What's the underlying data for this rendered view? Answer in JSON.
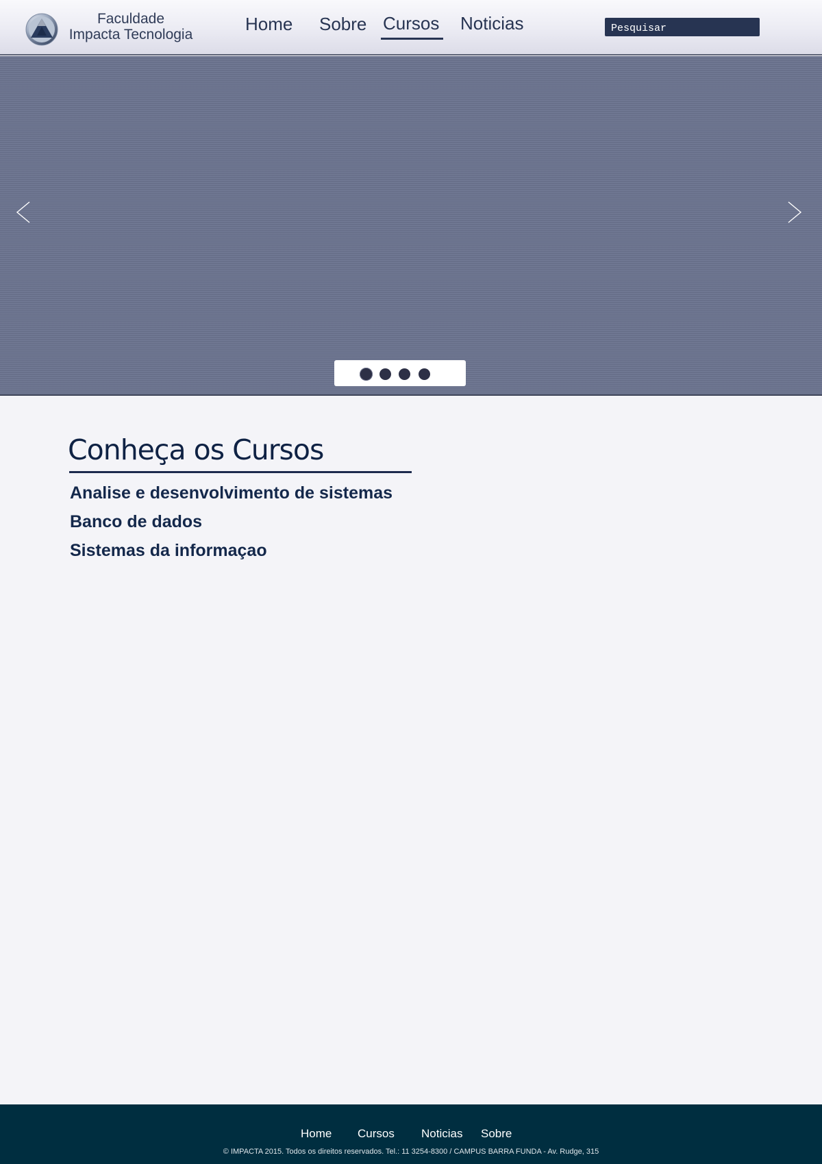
{
  "header": {
    "brand_line1": "Faculdade",
    "brand_line2": "Impacta Tecnologia",
    "nav": {
      "home": "Home",
      "sobre": "Sobre",
      "cursos": "Cursos",
      "noticias": "Noticias"
    },
    "active_nav": "Cursos",
    "search_placeholder": "Pesquisar"
  },
  "slider": {
    "prev_icon": "chevron-left-icon",
    "next_icon": "chevron-right-icon",
    "slide_count": 4,
    "active_slide": 1
  },
  "courses": {
    "title": "Conheça os Cursos",
    "items": [
      "Analise e desenvolvimento de sistemas",
      "Banco de dados",
      "Sistemas da informaçao"
    ]
  },
  "footer": {
    "links": {
      "home": "Home",
      "cursos": "Cursos",
      "noticias": "Noticias",
      "sobre": "Sobre"
    },
    "copyright": "© IMPACTA 2015. Todos os direitos reservados. Tel.: 11 3254-8300 / CAMPUS BARRA FUNDA - Av. Rudge, 315"
  },
  "colors": {
    "header_nav_text": "#273452",
    "hero_bg": "#6c7490",
    "course_text": "#14284b",
    "footer_bg": "#002e40"
  }
}
